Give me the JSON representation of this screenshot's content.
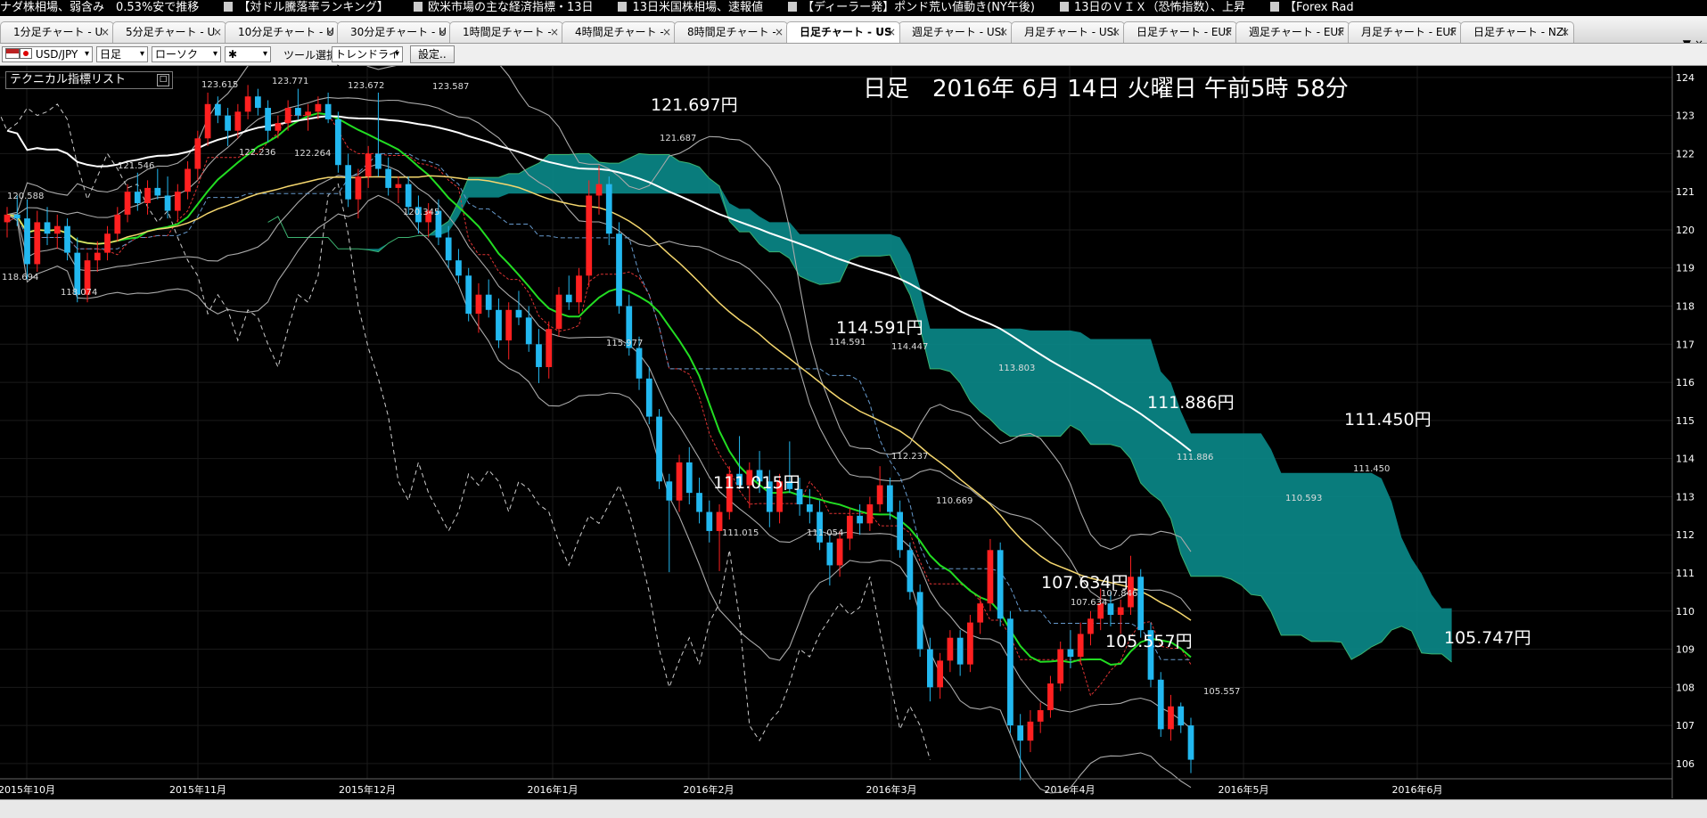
{
  "ticker": [
    "ナダ株相場、弱含み　0.53%安で推移",
    "【対ドル騰落率ランキング】",
    "欧米市場の主な経済指標・13日",
    "13日米国株相場、速報値",
    "【ディーラー発】ポンド荒い値動き(NY午後)",
    "13日のＶＩＸ（恐怖指数）、上昇",
    "【Forex Rad"
  ],
  "tabs": [
    {
      "label": "1分足チャート - U",
      "active": false
    },
    {
      "label": "5分足チャート - U",
      "active": false
    },
    {
      "label": "10分足チャート - U",
      "active": false
    },
    {
      "label": "30分足チャート - U",
      "active": false
    },
    {
      "label": "1時間足チャート -",
      "active": false
    },
    {
      "label": "4時間足チャート -",
      "active": false
    },
    {
      "label": "8時間足チャート -",
      "active": false
    },
    {
      "label": "日足チャート - US",
      "active": true
    },
    {
      "label": "週足チャート - USI",
      "active": false
    },
    {
      "label": "月足チャート - USI",
      "active": false
    },
    {
      "label": "日足チャート - EUF",
      "active": false
    },
    {
      "label": "週足チャート - EUF",
      "active": false
    },
    {
      "label": "月足チャート - EUF",
      "active": false
    },
    {
      "label": "日足チャート - NZI",
      "active": false
    }
  ],
  "tab_close": "×",
  "tab_menu": "▼",
  "tab_close_all": "×",
  "toolbar": {
    "symbol": "USD/JPY",
    "timeframe": "日足",
    "chart_type": "ローソク",
    "marker": "✱",
    "tool_label": "ツール選択",
    "tool_value": "トレンドライン",
    "settings": "設定..",
    "arrow": "▾"
  },
  "indicator_list": {
    "label": "テクニカル指標リスト",
    "button": "□"
  },
  "chart_data": {
    "type": "candlestick",
    "title": "日足　2016年 6月 14日 火曜日 午前5時 58分",
    "ylim": [
      105.6,
      124.3
    ],
    "y_ticks": [
      "124",
      "123",
      "122",
      "121",
      "120",
      "119",
      "118",
      "117",
      "116",
      "115",
      "114",
      "113",
      "112",
      "111",
      "110",
      "109",
      "108",
      "107",
      "106"
    ],
    "x_labels": [
      "2015年10月",
      "2015年11月",
      "2015年12月",
      "2016年1月",
      "2016年2月",
      "2016年3月",
      "2016年4月",
      "2016年5月",
      "2016年6月"
    ],
    "small_labels": [
      "120.588",
      "118.694",
      "118.074",
      "121.546",
      "123.615",
      "122.236",
      "123.771",
      "122.264",
      "123.672",
      "123.587",
      "120.345",
      "115.977",
      "121.687",
      "111.015",
      "111.054",
      "114.591",
      "114.447",
      "112.237",
      "113.803",
      "110.669",
      "107.634",
      "107.846",
      "111.886",
      "105.557",
      "110.593",
      "111.450"
    ],
    "callouts": [
      "121.697円",
      "111.015円",
      "114.591円",
      "111.886円",
      "111.450円",
      "107.634円",
      "105.557円",
      "105.747円"
    ],
    "candles": [
      [
        120.2,
        120.6,
        119.8,
        120.4
      ],
      [
        120.4,
        120.9,
        120.1,
        120.3
      ],
      [
        120.3,
        120.8,
        118.7,
        119.1
      ],
      [
        119.1,
        120.5,
        118.9,
        120.2
      ],
      [
        120.2,
        120.6,
        119.6,
        119.9
      ],
      [
        119.9,
        120.4,
        119.5,
        120.1
      ],
      [
        120.1,
        120.3,
        119.2,
        119.4
      ],
      [
        119.4,
        119.8,
        118.1,
        118.3
      ],
      [
        118.3,
        119.4,
        118.1,
        119.2
      ],
      [
        119.2,
        119.7,
        118.9,
        119.4
      ],
      [
        119.4,
        120.1,
        119.2,
        119.9
      ],
      [
        119.9,
        120.6,
        119.7,
        120.4
      ],
      [
        120.4,
        121.2,
        120.2,
        121.0
      ],
      [
        121.0,
        121.5,
        120.5,
        120.7
      ],
      [
        120.7,
        121.3,
        120.4,
        121.1
      ],
      [
        121.1,
        121.6,
        120.8,
        120.9
      ],
      [
        120.9,
        121.4,
        120.3,
        120.5
      ],
      [
        120.5,
        121.2,
        120.2,
        121.0
      ],
      [
        121.0,
        121.8,
        120.8,
        121.6
      ],
      [
        121.6,
        122.6,
        121.3,
        122.4
      ],
      [
        122.4,
        123.6,
        122.2,
        123.3
      ],
      [
        123.3,
        123.5,
        122.8,
        123.0
      ],
      [
        123.0,
        123.2,
        122.2,
        122.6
      ],
      [
        122.6,
        123.3,
        122.4,
        123.1
      ],
      [
        123.1,
        123.8,
        122.9,
        123.5
      ],
      [
        123.5,
        123.7,
        123.0,
        123.2
      ],
      [
        123.2,
        123.4,
        122.3,
        122.6
      ],
      [
        122.6,
        123.0,
        122.4,
        122.8
      ],
      [
        122.8,
        123.4,
        122.6,
        123.2
      ],
      [
        123.2,
        123.7,
        122.9,
        123.0
      ],
      [
        123.0,
        123.3,
        122.6,
        123.1
      ],
      [
        123.1,
        123.5,
        122.9,
        123.3
      ],
      [
        123.3,
        123.6,
        122.8,
        122.9
      ],
      [
        122.9,
        123.1,
        121.5,
        121.7
      ],
      [
        121.7,
        122.0,
        120.6,
        120.8
      ],
      [
        120.8,
        121.6,
        120.3,
        121.4
      ],
      [
        121.4,
        122.2,
        121.1,
        122.0
      ],
      [
        122.0,
        123.6,
        121.4,
        121.6
      ],
      [
        121.6,
        121.9,
        120.9,
        121.1
      ],
      [
        121.1,
        121.4,
        120.7,
        121.2
      ],
      [
        121.2,
        121.4,
        120.4,
        120.6
      ],
      [
        120.6,
        120.9,
        119.9,
        120.2
      ],
      [
        120.2,
        120.7,
        119.8,
        120.5
      ],
      [
        120.5,
        120.8,
        119.6,
        119.8
      ],
      [
        119.8,
        120.1,
        119.0,
        119.2
      ],
      [
        119.2,
        119.5,
        118.6,
        118.8
      ],
      [
        118.8,
        119.0,
        117.6,
        117.8
      ],
      [
        117.8,
        118.6,
        117.3,
        118.3
      ],
      [
        118.3,
        118.7,
        117.7,
        117.9
      ],
      [
        117.9,
        118.2,
        116.9,
        117.1
      ],
      [
        117.1,
        118.1,
        116.6,
        117.9
      ],
      [
        117.9,
        118.4,
        117.5,
        117.7
      ],
      [
        117.7,
        118.0,
        116.8,
        117.0
      ],
      [
        117.0,
        117.4,
        115.98,
        116.4
      ],
      [
        116.4,
        117.6,
        116.1,
        117.4
      ],
      [
        117.4,
        118.5,
        117.2,
        118.3
      ],
      [
        118.3,
        118.8,
        117.9,
        118.1
      ],
      [
        118.1,
        119.0,
        117.8,
        118.8
      ],
      [
        118.8,
        121.3,
        118.5,
        120.9
      ],
      [
        120.9,
        121.69,
        120.4,
        121.2
      ],
      [
        121.2,
        121.4,
        119.6,
        119.9
      ],
      [
        119.9,
        120.2,
        117.8,
        118.0
      ],
      [
        118.0,
        118.3,
        116.7,
        116.9
      ],
      [
        116.9,
        117.2,
        115.8,
        116.1
      ],
      [
        116.1,
        116.4,
        114.9,
        115.1
      ],
      [
        115.1,
        115.3,
        113.2,
        113.4
      ],
      [
        113.4,
        113.6,
        111.02,
        112.9
      ],
      [
        112.9,
        114.1,
        112.6,
        113.9
      ],
      [
        113.9,
        114.3,
        112.8,
        113.1
      ],
      [
        113.1,
        113.5,
        112.3,
        112.6
      ],
      [
        112.6,
        112.9,
        111.8,
        112.1
      ],
      [
        112.1,
        112.8,
        111.05,
        112.6
      ],
      [
        112.6,
        113.8,
        112.4,
        113.6
      ],
      [
        113.6,
        114.59,
        113.2,
        113.3
      ],
      [
        113.3,
        113.9,
        112.7,
        113.7
      ],
      [
        113.7,
        114.2,
        113.1,
        113.4
      ],
      [
        113.4,
        113.7,
        112.2,
        112.6
      ],
      [
        112.6,
        113.6,
        112.3,
        113.4
      ],
      [
        113.4,
        114.45,
        113.1,
        113.2
      ],
      [
        113.2,
        113.5,
        112.5,
        112.8
      ],
      [
        112.8,
        113.2,
        112.3,
        112.6
      ],
      [
        112.6,
        112.9,
        111.6,
        111.8
      ],
      [
        111.8,
        112.0,
        110.67,
        111.2
      ],
      [
        111.2,
        112.1,
        110.9,
        111.9
      ],
      [
        111.9,
        112.7,
        111.6,
        112.5
      ],
      [
        112.5,
        112.8,
        112.0,
        112.3
      ],
      [
        112.3,
        113.0,
        112.1,
        112.8
      ],
      [
        112.8,
        113.8,
        112.6,
        113.3
      ],
      [
        113.3,
        113.5,
        112.4,
        112.6
      ],
      [
        112.6,
        112.9,
        111.4,
        111.6
      ],
      [
        111.6,
        111.8,
        110.3,
        110.5
      ],
      [
        110.5,
        110.7,
        108.8,
        109.0
      ],
      [
        109.0,
        109.3,
        107.63,
        108.0
      ],
      [
        108.0,
        108.9,
        107.7,
        108.7
      ],
      [
        108.7,
        109.5,
        108.4,
        109.3
      ],
      [
        109.3,
        109.5,
        108.3,
        108.6
      ],
      [
        108.6,
        109.9,
        108.4,
        109.7
      ],
      [
        109.7,
        110.4,
        109.4,
        110.2
      ],
      [
        110.2,
        111.89,
        110.0,
        111.6
      ],
      [
        111.6,
        111.8,
        109.6,
        109.8
      ],
      [
        109.8,
        110.0,
        106.8,
        107.0
      ],
      [
        107.0,
        107.3,
        105.56,
        106.6
      ],
      [
        106.6,
        107.4,
        106.3,
        107.1
      ],
      [
        107.1,
        107.6,
        106.8,
        107.4
      ],
      [
        107.4,
        108.3,
        107.2,
        108.1
      ],
      [
        108.1,
        109.2,
        107.9,
        109.0
      ],
      [
        109.0,
        109.5,
        108.5,
        108.8
      ],
      [
        108.8,
        109.7,
        108.6,
        109.4
      ],
      [
        109.4,
        110.0,
        109.1,
        109.8
      ],
      [
        109.8,
        110.59,
        109.5,
        110.2
      ],
      [
        110.2,
        110.5,
        109.6,
        109.9
      ],
      [
        109.9,
        110.3,
        109.4,
        110.1
      ],
      [
        110.1,
        111.45,
        109.9,
        110.9
      ],
      [
        110.9,
        111.1,
        109.3,
        109.5
      ],
      [
        109.5,
        109.7,
        108.0,
        108.2
      ],
      [
        108.2,
        108.4,
        106.7,
        106.9
      ],
      [
        106.9,
        107.8,
        106.6,
        107.5
      ],
      [
        107.5,
        107.6,
        106.8,
        107.0
      ],
      [
        107.0,
        107.2,
        105.75,
        106.1
      ]
    ]
  }
}
